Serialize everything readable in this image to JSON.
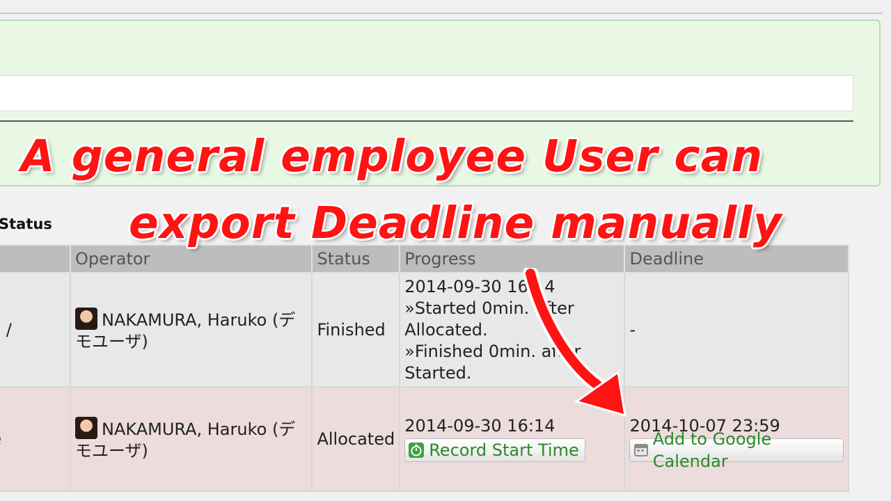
{
  "form": {
    "input_value": ""
  },
  "section": {
    "label": "Status"
  },
  "table": {
    "headers": {
      "title": "",
      "operator": "Operator",
      "status": "Status",
      "progress": "Progress",
      "deadline": "Deadline"
    },
    "rows": [
      {
        "title": "/ Blog",
        "operator": "NAKAMURA, Haruko (デモユーザ)",
        "status": "Finished",
        "progress_lines": [
          "2014-09-30 16:14",
          "»Started 0min. after Allocated.",
          "»Finished 0min. after Started."
        ],
        "deadline": "-"
      },
      {
        "title": "date",
        "operator": "NAKAMURA, Haruko (デモユーザ)",
        "status": "Allocated",
        "progress_lines": [
          "2014-09-30 16:14"
        ],
        "progress_button": "Record Start Time",
        "deadline": "2014-10-07 23:59",
        "deadline_button": "Add to Google Calendar"
      }
    ]
  },
  "annotation": {
    "line1": "A general employee User can",
    "line2": "export Deadline manually",
    "color": "#ff1313"
  }
}
